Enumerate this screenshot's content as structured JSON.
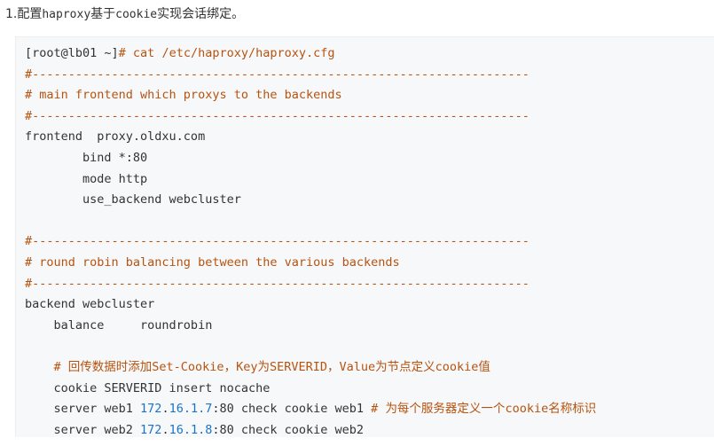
{
  "heading": {
    "prefix": "1.配置",
    "code1": "haproxy",
    "middle": "基于",
    "code2": "cookie",
    "suffix": "实现会话绑定。"
  },
  "code": {
    "lines": [
      [
        {
          "t": "[root@lb01 ~]",
          "c": ""
        },
        {
          "t": "# cat /etc/haproxy/haproxy.cfg",
          "c": "comment"
        }
      ],
      [
        {
          "t": "#---------------------------------------------------------------------",
          "c": "comment"
        }
      ],
      [
        {
          "t": "# main frontend which proxys to the backends",
          "c": "comment"
        }
      ],
      [
        {
          "t": "#---------------------------------------------------------------------",
          "c": "comment"
        }
      ],
      [
        {
          "t": "frontend  proxy.oldxu.com",
          "c": ""
        }
      ],
      [
        {
          "t": "        bind *:80",
          "c": ""
        }
      ],
      [
        {
          "t": "        mode http",
          "c": ""
        }
      ],
      [
        {
          "t": "        use_backend webcluster",
          "c": ""
        }
      ],
      [
        {
          "t": "",
          "c": ""
        }
      ],
      [
        {
          "t": "#---------------------------------------------------------------------",
          "c": "comment"
        }
      ],
      [
        {
          "t": "# round robin balancing between the various backends",
          "c": "comment"
        }
      ],
      [
        {
          "t": "#---------------------------------------------------------------------",
          "c": "comment"
        }
      ],
      [
        {
          "t": "backend webcluster",
          "c": ""
        }
      ],
      [
        {
          "t": "    balance     roundrobin",
          "c": ""
        }
      ],
      [
        {
          "t": "",
          "c": ""
        }
      ],
      [
        {
          "t": "    ",
          "c": ""
        },
        {
          "t": "# ",
          "c": "comment"
        },
        {
          "t": "回传数据时添加",
          "c": "comment cjk"
        },
        {
          "t": "Set-Cookie",
          "c": "comment"
        },
        {
          "t": "，",
          "c": "comment cjk"
        },
        {
          "t": "Key",
          "c": "comment"
        },
        {
          "t": "为",
          "c": "comment cjk"
        },
        {
          "t": "SERVERID",
          "c": "comment"
        },
        {
          "t": "，",
          "c": "comment cjk"
        },
        {
          "t": "Value",
          "c": "comment"
        },
        {
          "t": "为节点定义",
          "c": "comment cjk"
        },
        {
          "t": "cookie",
          "c": "comment"
        },
        {
          "t": "值",
          "c": "comment cjk"
        }
      ],
      [
        {
          "t": "    cookie SERVERID insert nocache",
          "c": ""
        }
      ],
      [
        {
          "t": "    server web1 ",
          "c": ""
        },
        {
          "t": "172",
          "c": "number"
        },
        {
          "t": ".",
          "c": ""
        },
        {
          "t": "16.1.7",
          "c": "number"
        },
        {
          "t": ":80 check cookie web1 ",
          "c": ""
        },
        {
          "t": "# ",
          "c": "comment"
        },
        {
          "t": "为每个服务器定义一个",
          "c": "comment cjk"
        },
        {
          "t": "cookie",
          "c": "comment"
        },
        {
          "t": "名称标识",
          "c": "comment cjk"
        }
      ],
      [
        {
          "t": "    server web2 ",
          "c": ""
        },
        {
          "t": "172",
          "c": "number"
        },
        {
          "t": ".",
          "c": ""
        },
        {
          "t": "16.1.8",
          "c": "number"
        },
        {
          "t": ":80 check cookie web2",
          "c": ""
        }
      ]
    ]
  },
  "colors": {
    "comment": "#b8530f",
    "number": "#1a73c8",
    "text": "#333333",
    "code_background": "#f6f8fa"
  }
}
